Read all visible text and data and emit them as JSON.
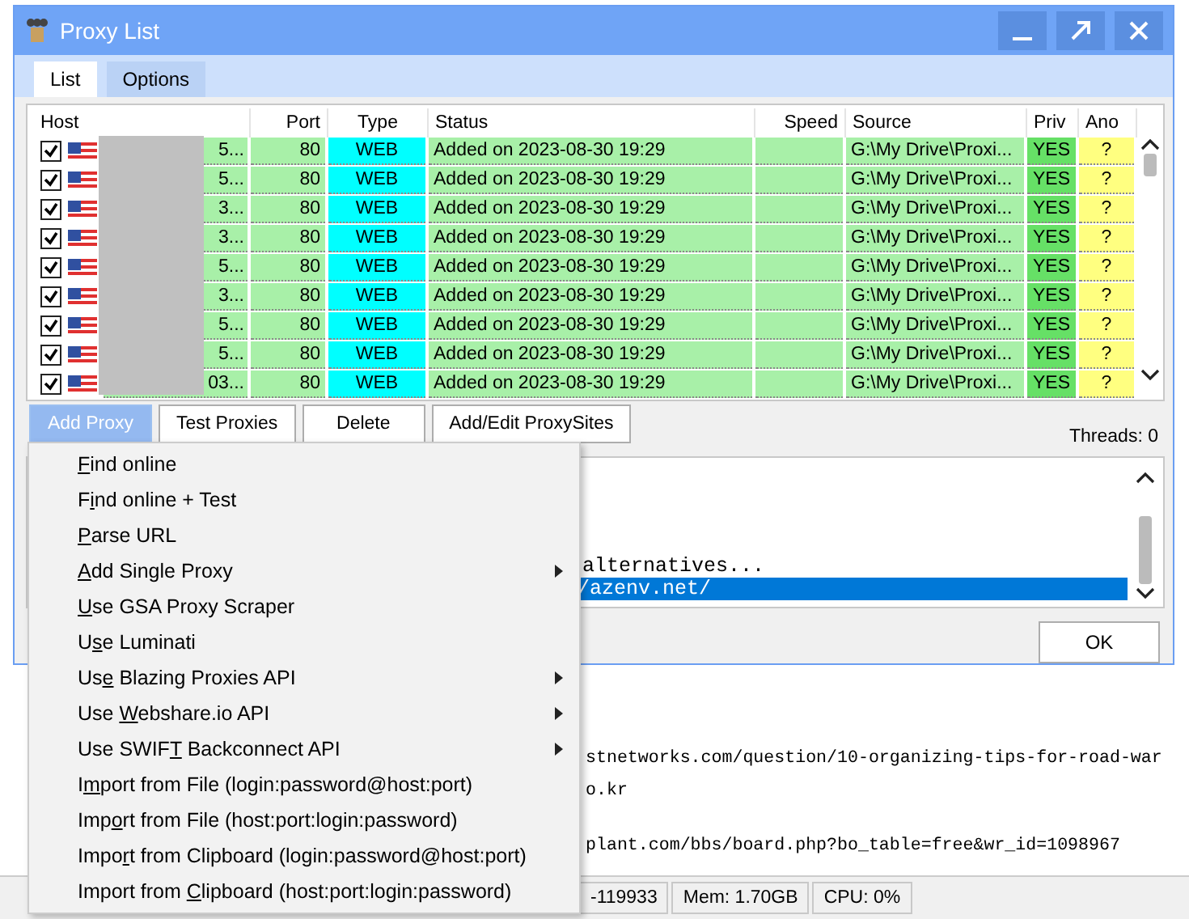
{
  "window": {
    "title": "Proxy List"
  },
  "tabs": [
    {
      "label": "List",
      "selected": true
    },
    {
      "label": "Options",
      "selected": false
    }
  ],
  "table": {
    "columns": [
      "Host",
      "Port",
      "Type",
      "Status",
      "Speed",
      "Source",
      "Priv",
      "Ano"
    ],
    "rows": [
      {
        "checked": true,
        "host": "5...",
        "port": "80",
        "type": "WEB",
        "status": "Added on 2023-08-30 19:29",
        "source": "G:\\My Drive\\Proxi...",
        "priv": "YES",
        "ano": "?"
      },
      {
        "checked": true,
        "host": "5...",
        "port": "80",
        "type": "WEB",
        "status": "Added on 2023-08-30 19:29",
        "source": "G:\\My Drive\\Proxi...",
        "priv": "YES",
        "ano": "?"
      },
      {
        "checked": true,
        "host": "3...",
        "port": "80",
        "type": "WEB",
        "status": "Added on 2023-08-30 19:29",
        "source": "G:\\My Drive\\Proxi...",
        "priv": "YES",
        "ano": "?"
      },
      {
        "checked": true,
        "host": "3...",
        "port": "80",
        "type": "WEB",
        "status": "Added on 2023-08-30 19:29",
        "source": "G:\\My Drive\\Proxi...",
        "priv": "YES",
        "ano": "?"
      },
      {
        "checked": true,
        "host": "5...",
        "port": "80",
        "type": "WEB",
        "status": "Added on 2023-08-30 19:29",
        "source": "G:\\My Drive\\Proxi...",
        "priv": "YES",
        "ano": "?"
      },
      {
        "checked": true,
        "host": "3...",
        "port": "80",
        "type": "WEB",
        "status": "Added on 2023-08-30 19:29",
        "source": "G:\\My Drive\\Proxi...",
        "priv": "YES",
        "ano": "?"
      },
      {
        "checked": true,
        "host": "5...",
        "port": "80",
        "type": "WEB",
        "status": "Added on 2023-08-30 19:29",
        "source": "G:\\My Drive\\Proxi...",
        "priv": "YES",
        "ano": "?"
      },
      {
        "checked": true,
        "host": "5...",
        "port": "80",
        "type": "WEB",
        "status": "Added on 2023-08-30 19:29",
        "source": "G:\\My Drive\\Proxi...",
        "priv": "YES",
        "ano": "?"
      },
      {
        "checked": true,
        "host": "03...",
        "port": "80",
        "type": "WEB",
        "status": "Added on 2023-08-30 19:29",
        "source": "G:\\My Drive\\Proxi...",
        "priv": "YES",
        "ano": "?"
      }
    ]
  },
  "buttons": [
    {
      "label": "Add Proxy",
      "pressed": true
    },
    {
      "label": "Test Proxies",
      "pressed": false
    },
    {
      "label": "Delete",
      "pressed": false
    },
    {
      "label": "Add/Edit ProxySites",
      "pressed": false
    }
  ],
  "threads": "Threads: 0",
  "log": [
    {
      "text": "alternatives...",
      "selected": false
    },
    {
      "text": "/azenv.net/",
      "selected": true
    }
  ],
  "ok_button": "OK",
  "background_log": [
    "stnetworks.com/question/10-organizing-tips-for-road-war",
    "o.kr",
    "plant.com/bbs/board.php?bo_table=free&wr_id=1098967"
  ],
  "status_bar": [
    "-119933",
    "Mem: 1.70GB",
    "CPU: 0%"
  ],
  "menu": [
    {
      "key": "F",
      "after": "ind online",
      "submenu": false
    },
    {
      "before": "F",
      "key": "i",
      "after": "nd online + Test",
      "submenu": false
    },
    {
      "key": "P",
      "after": "arse URL",
      "submenu": false
    },
    {
      "key": "A",
      "after": "dd Single Proxy",
      "submenu": true
    },
    {
      "key": "U",
      "after": "se GSA Proxy Scraper",
      "submenu": false
    },
    {
      "before": "U",
      "key": "s",
      "after": "e Luminati",
      "submenu": false
    },
    {
      "before": "Us",
      "key": "e",
      "after": " Blazing Proxies API",
      "submenu": true
    },
    {
      "before": "Use ",
      "key": "W",
      "after": "ebshare.io API",
      "submenu": true
    },
    {
      "before": "Use SWIF",
      "key": "T",
      "after": " Backconnect API",
      "submenu": true
    },
    {
      "before": "I",
      "key": "m",
      "after": "port from File (login:password@host:port)",
      "submenu": false
    },
    {
      "before": "Imp",
      "key": "o",
      "after": "rt from File (host:port:login:password)",
      "submenu": false
    },
    {
      "before": "Impo",
      "key": "r",
      "after": "t from Clipboard (login:password@host:port)",
      "submenu": false
    },
    {
      "before": "Import from ",
      "key": "C",
      "after": "lipboard (host:port:login:password)",
      "submenu": false
    }
  ]
}
